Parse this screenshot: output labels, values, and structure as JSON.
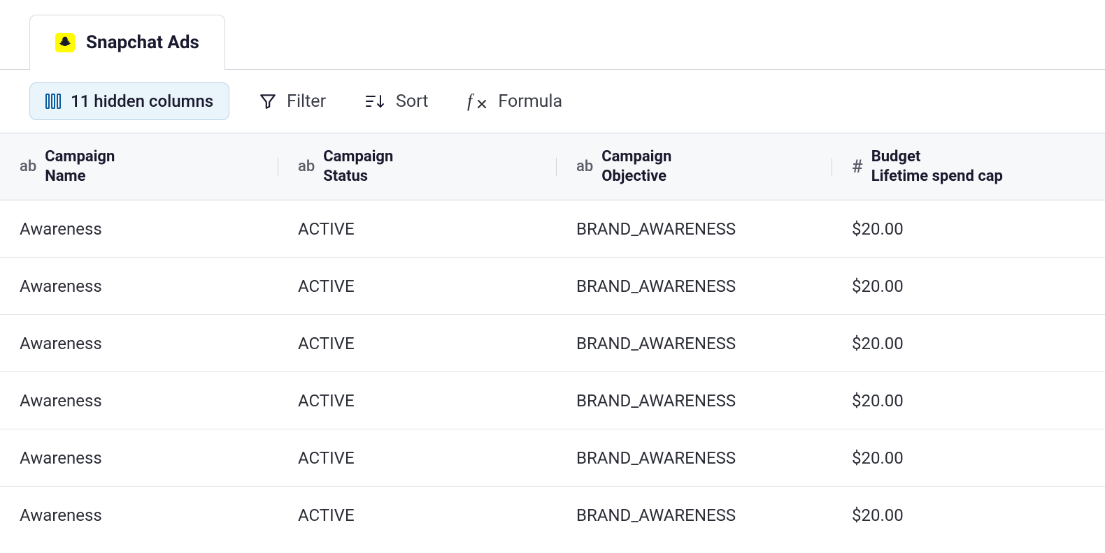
{
  "tab": {
    "label": "Snapchat Ads",
    "icon": "snapchat-icon"
  },
  "toolbar": {
    "hidden_columns": "11 hidden columns",
    "filter": "Filter",
    "sort": "Sort",
    "formula": "Formula"
  },
  "columns": [
    {
      "type": "ab",
      "label_line1": "Campaign",
      "label_line2": "Name"
    },
    {
      "type": "ab",
      "label_line1": "Campaign",
      "label_line2": "Status"
    },
    {
      "type": "ab",
      "label_line1": "Campaign",
      "label_line2": "Objective"
    },
    {
      "type": "#",
      "label_line1": "Budget",
      "label_line2": "Lifetime spend cap"
    }
  ],
  "rows": [
    {
      "name": "Awareness",
      "status": "ACTIVE",
      "objective": "BRAND_AWARENESS",
      "budget": "$20.00"
    },
    {
      "name": "Awareness",
      "status": "ACTIVE",
      "objective": "BRAND_AWARENESS",
      "budget": "$20.00"
    },
    {
      "name": "Awareness",
      "status": "ACTIVE",
      "objective": "BRAND_AWARENESS",
      "budget": "$20.00"
    },
    {
      "name": "Awareness",
      "status": "ACTIVE",
      "objective": "BRAND_AWARENESS",
      "budget": "$20.00"
    },
    {
      "name": "Awareness",
      "status": "ACTIVE",
      "objective": "BRAND_AWARENESS",
      "budget": "$20.00"
    },
    {
      "name": "Awareness",
      "status": "ACTIVE",
      "objective": "BRAND_AWARENESS",
      "budget": "$20.00"
    }
  ]
}
